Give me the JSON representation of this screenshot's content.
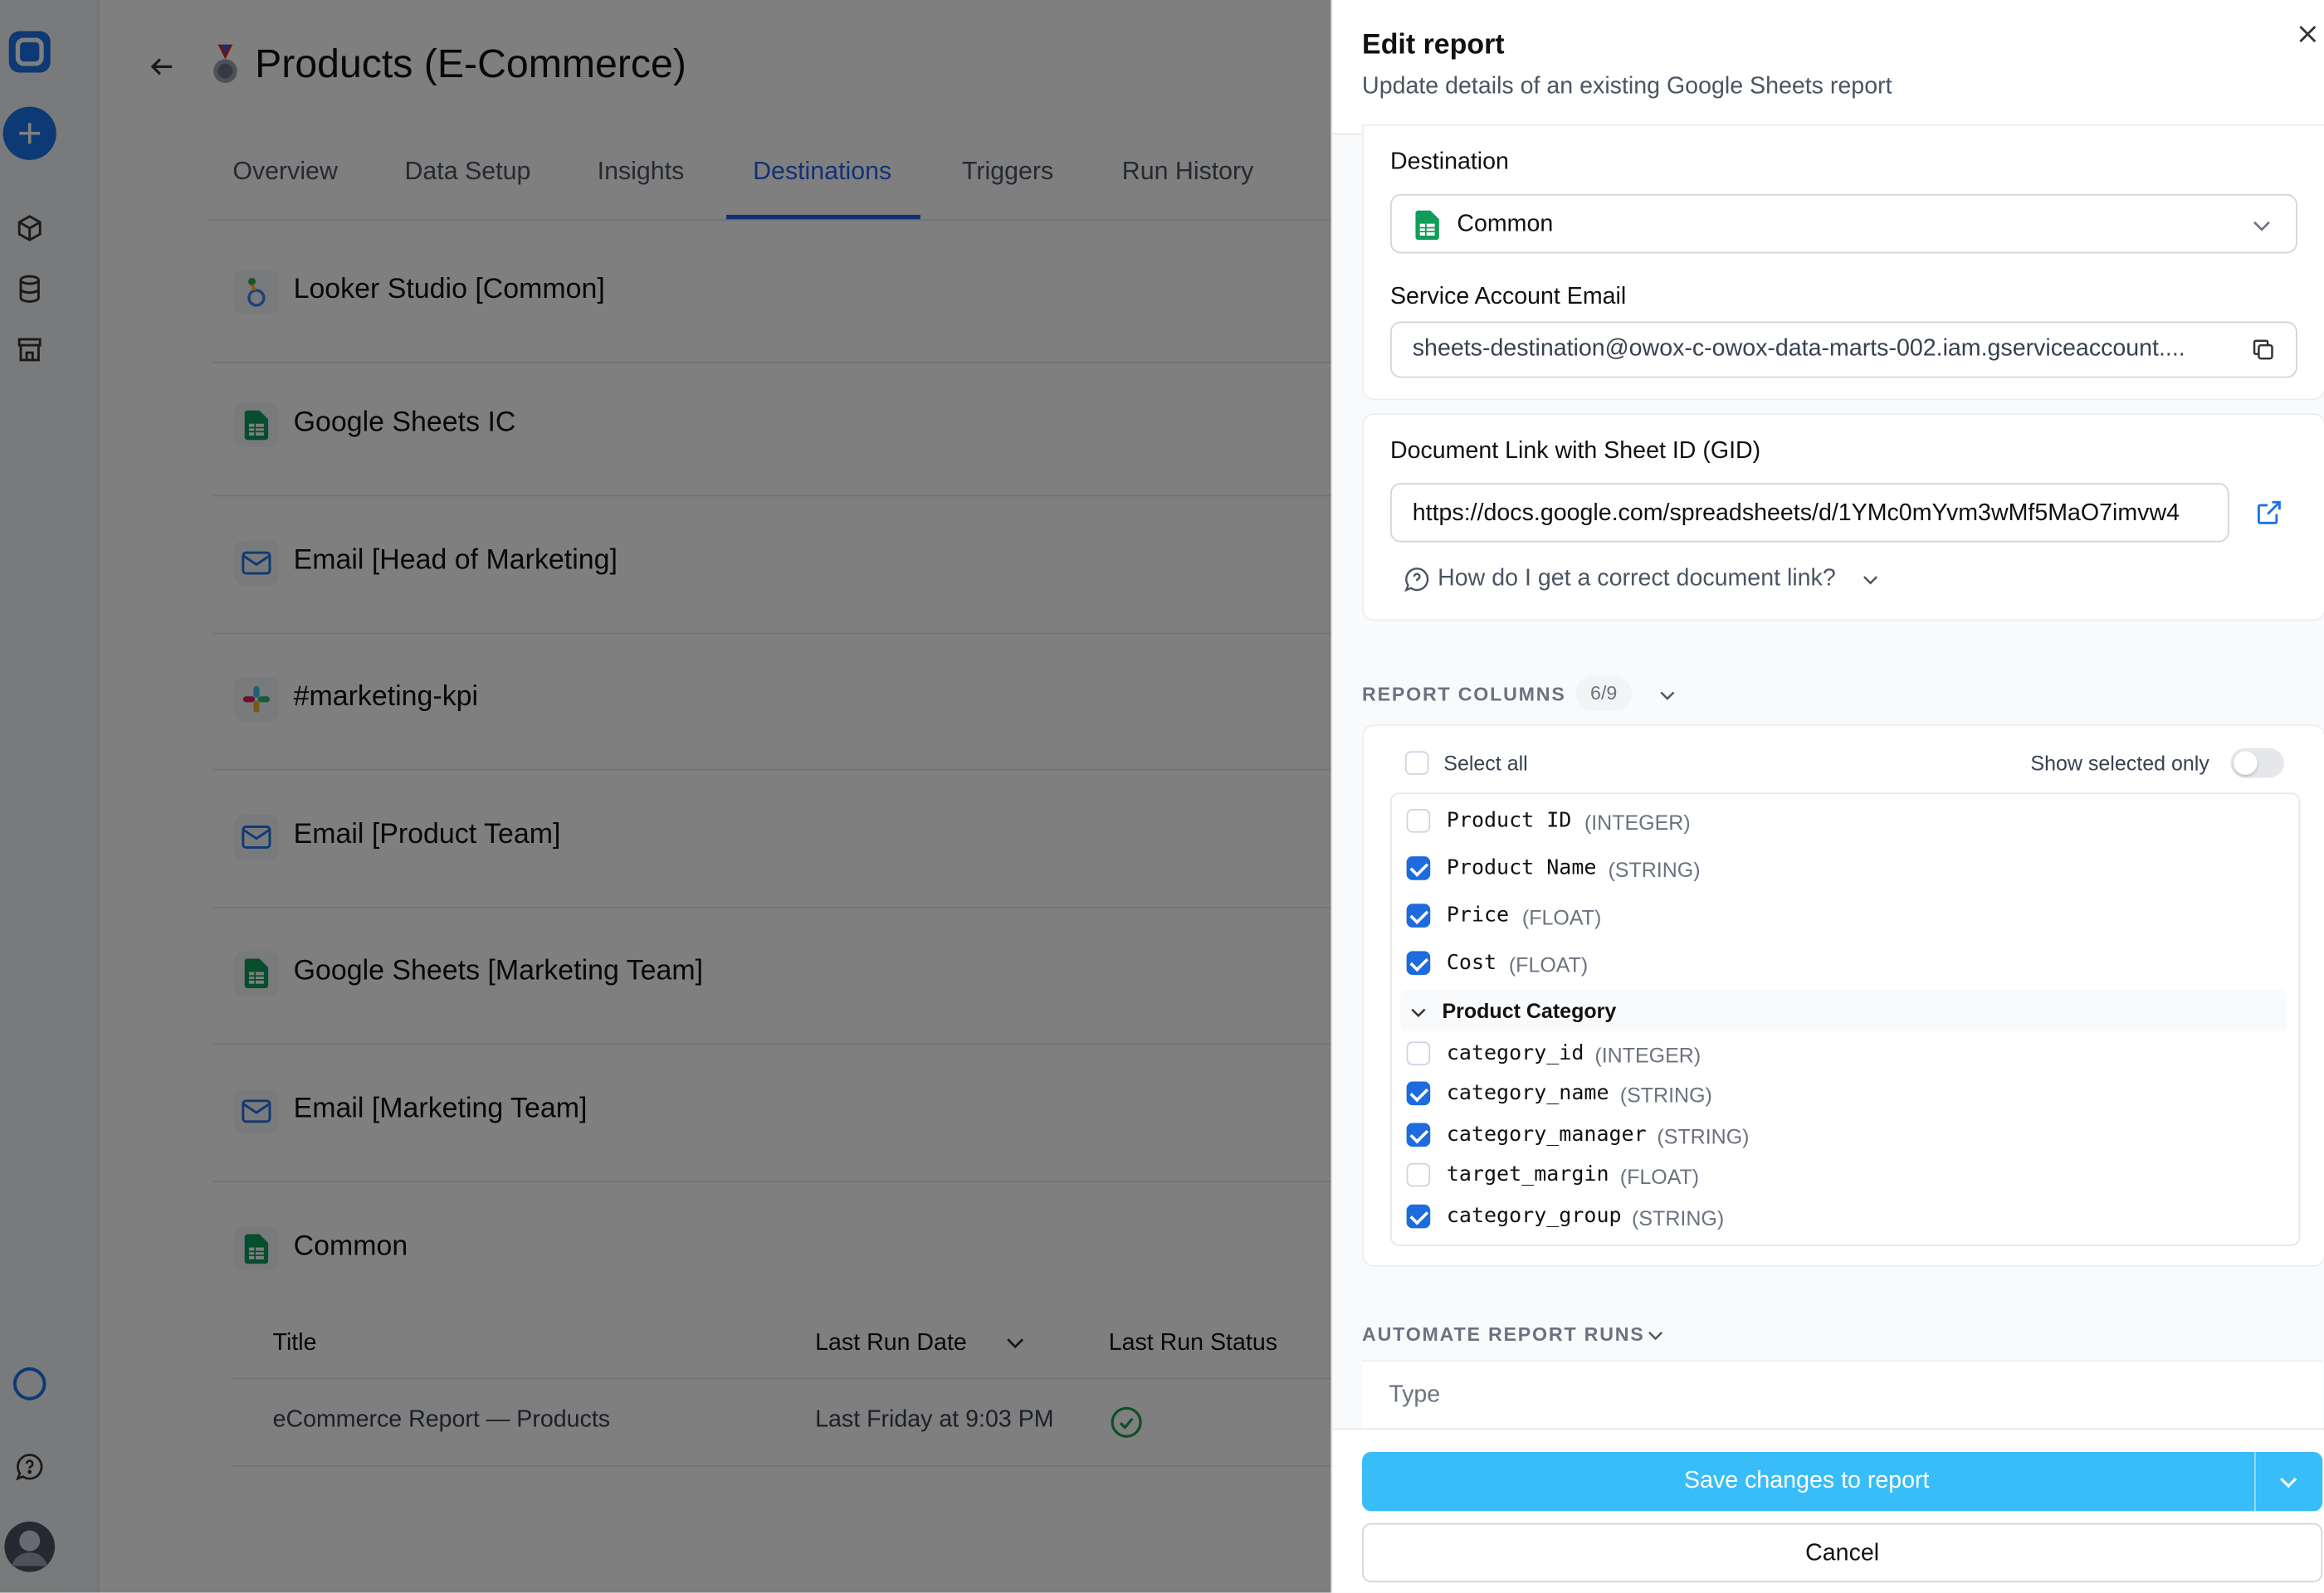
{
  "page": {
    "title": "Products (E-Commerce)"
  },
  "tabs": [
    "Overview",
    "Data Setup",
    "Insights",
    "Destinations",
    "Triggers",
    "Run History"
  ],
  "destinations": [
    {
      "label": "Looker Studio [Common]",
      "icon": "looker-studio-icon"
    },
    {
      "label": "Google Sheets IC",
      "icon": "google-sheets-icon"
    },
    {
      "label": "Email [Head of Marketing]",
      "icon": "email-icon"
    },
    {
      "label": "#marketing-kpi",
      "icon": "slack-icon"
    },
    {
      "label": "Email [Product Team]",
      "icon": "email-icon"
    },
    {
      "label": "Google Sheets [Marketing Team]",
      "icon": "google-sheets-icon"
    },
    {
      "label": "Email [Marketing Team]",
      "icon": "email-icon"
    },
    {
      "label": "Common",
      "icon": "google-sheets-icon"
    }
  ],
  "reports_table": {
    "headers": [
      "Title",
      "Last Run Date",
      "Last Run Status"
    ],
    "rows": [
      {
        "title": "eCommerce Report — Products",
        "last_run": "Last Friday at 9:03 PM",
        "status": "success"
      }
    ]
  },
  "drawer": {
    "title": "Edit report",
    "subtitle": "Update details of an existing Google Sheets report",
    "destination_label": "Destination",
    "destination_value": "Common",
    "service_account_label": "Service Account Email",
    "service_account_value": "sheets-destination@owox-c-owox-data-marts-002.iam.gserviceaccount....",
    "doc_link_label": "Document Link with Sheet ID (GID)",
    "doc_link_value": "https://docs.google.com/spreadsheets/d/1YMc0mYvm3wMf5MaO7imvw4",
    "help_text": "How do I get a correct document link?",
    "report_columns_title": "REPORT COLUMNS",
    "report_columns_count": "6/9",
    "select_all": "Select all",
    "show_selected_only": "Show selected only",
    "columns": [
      {
        "name": "Product ID",
        "type": "(INTEGER)",
        "checked": false
      },
      {
        "name": "Product Name",
        "type": "(STRING)",
        "checked": true
      },
      {
        "name": "Price",
        "type": "(FLOAT)",
        "checked": true
      },
      {
        "name": "Cost",
        "type": "(FLOAT)",
        "checked": true
      }
    ],
    "group": {
      "label": "Product Category",
      "columns": [
        {
          "name": "category_id",
          "type": "(INTEGER)",
          "checked": false
        },
        {
          "name": "category_name",
          "type": "(STRING)",
          "checked": true
        },
        {
          "name": "category_manager",
          "type": "(STRING)",
          "checked": true
        },
        {
          "name": "target_margin",
          "type": "(FLOAT)",
          "checked": false
        },
        {
          "name": "category_group",
          "type": "(STRING)",
          "checked": true
        }
      ]
    },
    "automate_title": "AUTOMATE REPORT RUNS",
    "type_placeholder": "Type",
    "save_label": "Save changes to report",
    "cancel_label": "Cancel"
  },
  "colors": {
    "accent": "#2563eb",
    "save": "#38bdf8",
    "checkbox": "#1d6bdc",
    "sheets_green": "#0f9d58"
  }
}
